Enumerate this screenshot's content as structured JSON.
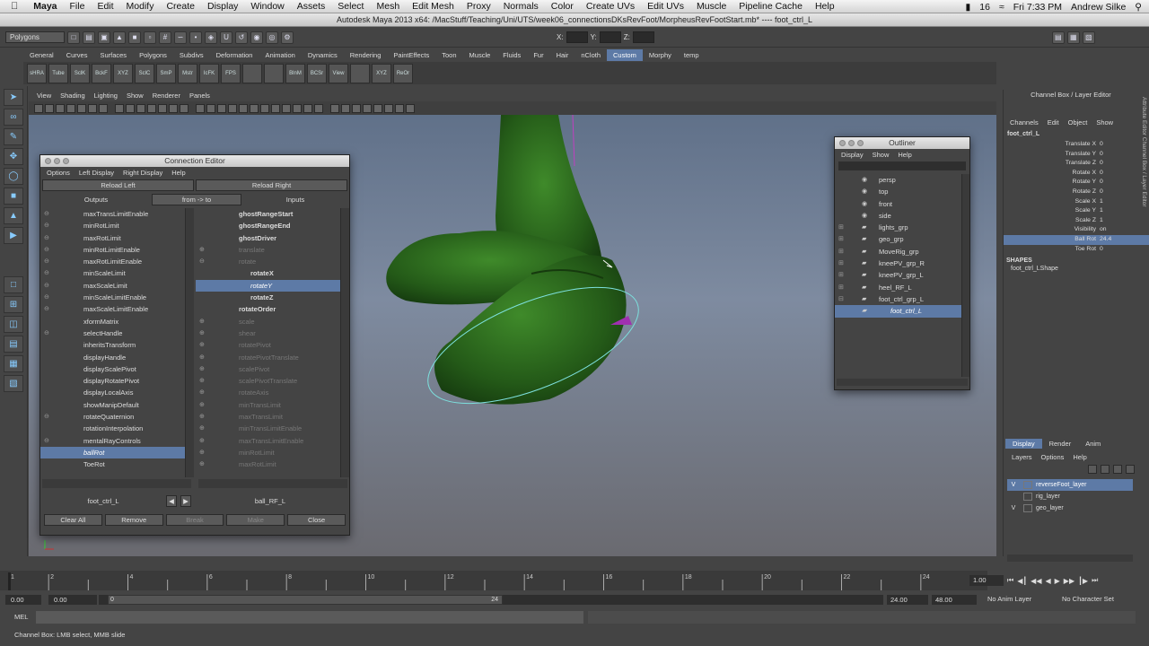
{
  "menubar": {
    "app": "Maya",
    "items": [
      "File",
      "Edit",
      "Modify",
      "Create",
      "Display",
      "Window",
      "Assets",
      "Select",
      "Mesh",
      "Edit Mesh",
      "Proxy",
      "Normals",
      "Color",
      "Create UVs",
      "Edit UVs",
      "Muscle",
      "Pipeline Cache",
      "Help"
    ],
    "battery": "16",
    "clock": "Fri 7:33 PM",
    "user": "Andrew Silke"
  },
  "title": "Autodesk Maya 2013 x64: /MacStuff/Teaching/Uni/UTS/week06_connectionsDKsRevFoot/MorpheusRevFootStart.mb*  ----  foot_ctrl_L",
  "status": {
    "mode": "Polygons",
    "x_label": "X:",
    "y_label": "Y:",
    "z_label": "Z:"
  },
  "shelf": {
    "tabs": [
      "General",
      "Curves",
      "Surfaces",
      "Polygons",
      "Subdivs",
      "Deformation",
      "Animation",
      "Dynamics",
      "Rendering",
      "PaintEffects",
      "Toon",
      "Muscle",
      "Fluids",
      "Fur",
      "Hair",
      "nCloth",
      "Custom",
      "Morphy",
      "temp"
    ],
    "active_tab": "Custom",
    "buttons": [
      "sHRA",
      "Tube",
      "SclK",
      "BckF",
      "XYZ",
      "SclC",
      "SmP",
      "Mstr",
      "IcFK",
      "FPS",
      "",
      "",
      "BlnM",
      "BCSr",
      "View",
      "",
      "XYZ",
      "ReOr"
    ]
  },
  "viewport": {
    "menu": [
      "View",
      "Shading",
      "Lighting",
      "Show",
      "Renderer",
      "Panels"
    ]
  },
  "connection_editor": {
    "title": "Connection Editor",
    "menu": [
      "Options",
      "Left Display",
      "Right Display",
      "Help"
    ],
    "reload_left": "Reload Left",
    "reload_right": "Reload Right",
    "outputs": "Outputs",
    "direction": "from -> to",
    "inputs": "Inputs",
    "left_items": [
      {
        "t": "maxTransLimitEnable",
        "ex": "⊖"
      },
      {
        "t": "minRotLimit",
        "ex": "⊖"
      },
      {
        "t": "maxRotLimit",
        "ex": "⊖"
      },
      {
        "t": "minRotLimitEnable",
        "ex": "⊖"
      },
      {
        "t": "maxRotLimitEnable",
        "ex": "⊖"
      },
      {
        "t": "minScaleLimit",
        "ex": "⊖"
      },
      {
        "t": "maxScaleLimit",
        "ex": "⊖"
      },
      {
        "t": "minScaleLimitEnable",
        "ex": "⊖"
      },
      {
        "t": "maxScaleLimitEnable",
        "ex": "⊖"
      },
      {
        "t": "xformMatrix",
        "ex": ""
      },
      {
        "t": "selectHandle",
        "ex": "⊖"
      },
      {
        "t": "inheritsTransform",
        "ex": ""
      },
      {
        "t": "displayHandle",
        "ex": ""
      },
      {
        "t": "displayScalePivot",
        "ex": ""
      },
      {
        "t": "displayRotatePivot",
        "ex": ""
      },
      {
        "t": "displayLocalAxis",
        "ex": ""
      },
      {
        "t": "showManipDefault",
        "ex": ""
      },
      {
        "t": "rotateQuaternion",
        "ex": "⊖"
      },
      {
        "t": "rotationInterpolation",
        "ex": ""
      },
      {
        "t": "mentalRayControls",
        "ex": "⊖"
      },
      {
        "t": "ballRot",
        "ex": "",
        "sel": true
      },
      {
        "t": "ToeRot",
        "ex": ""
      }
    ],
    "right_items": [
      {
        "t": "ghostRangeStart",
        "ex": "",
        "b": true
      },
      {
        "t": "ghostRangeEnd",
        "ex": "",
        "b": true
      },
      {
        "t": "ghostDriver",
        "ex": "",
        "b": true
      },
      {
        "t": "translate",
        "ex": "⊕",
        "d": true
      },
      {
        "t": "rotate",
        "ex": "⊖",
        "d": true
      },
      {
        "t": "rotateX",
        "ex": "",
        "b": true,
        "ind": true
      },
      {
        "t": "rotateY",
        "ex": "",
        "sel": true,
        "ind": true
      },
      {
        "t": "rotateZ",
        "ex": "",
        "b": true,
        "ind": true
      },
      {
        "t": "rotateOrder",
        "ex": "",
        "b": true
      },
      {
        "t": "scale",
        "ex": "⊕",
        "d": true
      },
      {
        "t": "shear",
        "ex": "⊕",
        "d": true
      },
      {
        "t": "rotatePivot",
        "ex": "⊕",
        "d": true
      },
      {
        "t": "rotatePivotTranslate",
        "ex": "⊕",
        "d": true
      },
      {
        "t": "scalePivot",
        "ex": "⊕",
        "d": true
      },
      {
        "t": "scalePivotTranslate",
        "ex": "⊕",
        "d": true
      },
      {
        "t": "rotateAxis",
        "ex": "⊕",
        "d": true
      },
      {
        "t": "minTransLimit",
        "ex": "⊕",
        "d": true
      },
      {
        "t": "maxTransLimit",
        "ex": "⊕",
        "d": true
      },
      {
        "t": "minTransLimitEnable",
        "ex": "⊕",
        "d": true
      },
      {
        "t": "maxTransLimitEnable",
        "ex": "⊕",
        "d": true
      },
      {
        "t": "minRotLimit",
        "ex": "⊕",
        "d": true
      },
      {
        "t": "maxRotLimit",
        "ex": "⊕",
        "d": true
      }
    ],
    "left_node": "foot_ctrl_L",
    "right_node": "ball_RF_L",
    "clear_all": "Clear All",
    "remove": "Remove",
    "break": "Break",
    "make": "Make",
    "close": "Close"
  },
  "outliner": {
    "title": "Outliner",
    "menu": [
      "Display",
      "Show",
      "Help"
    ],
    "items": [
      {
        "t": "persp",
        "ex": ""
      },
      {
        "t": "top",
        "ex": ""
      },
      {
        "t": "front",
        "ex": ""
      },
      {
        "t": "side",
        "ex": ""
      },
      {
        "t": "lights_grp",
        "ex": "⊞"
      },
      {
        "t": "geo_grp",
        "ex": "⊞"
      },
      {
        "t": "MoveRig_grp",
        "ex": "⊞"
      },
      {
        "t": "kneePV_grp_R",
        "ex": "⊞"
      },
      {
        "t": "kneePV_grp_L",
        "ex": "⊞"
      },
      {
        "t": "heel_RF_L",
        "ex": "⊞"
      },
      {
        "t": "foot_ctrl_grp_L",
        "ex": "⊟"
      },
      {
        "t": "foot_ctrl_L",
        "ex": "",
        "sel": true
      }
    ]
  },
  "channel_box": {
    "title": "Channel Box / Layer Editor",
    "menu": [
      "Channels",
      "Edit",
      "Object",
      "Show"
    ],
    "object": "foot_ctrl_L",
    "channels": [
      {
        "n": "Translate X",
        "v": "0"
      },
      {
        "n": "Translate Y",
        "v": "0"
      },
      {
        "n": "Translate Z",
        "v": "0"
      },
      {
        "n": "Rotate X",
        "v": "0"
      },
      {
        "n": "Rotate Y",
        "v": "0"
      },
      {
        "n": "Rotate Z",
        "v": "0"
      },
      {
        "n": "Scale X",
        "v": "1"
      },
      {
        "n": "Scale Y",
        "v": "1"
      },
      {
        "n": "Scale Z",
        "v": "1"
      },
      {
        "n": "Visibility",
        "v": "on"
      },
      {
        "n": "Ball Rot",
        "v": "24.4",
        "hl": true
      },
      {
        "n": "Toe Rot",
        "v": "0"
      }
    ],
    "shapes_label": "SHAPES",
    "shape": "foot_ctrl_LShape",
    "side_tabs": "Attribute Editor   Channel Box / Layer Editor"
  },
  "layers": {
    "tabs": [
      "Display",
      "Render",
      "Anim"
    ],
    "active": "Display",
    "menu": [
      "Layers",
      "Options",
      "Help"
    ],
    "items": [
      {
        "v": "V",
        "t": "reverseFoot_layer",
        "sel": true
      },
      {
        "v": "",
        "t": "rig_layer"
      },
      {
        "v": "V",
        "t": "geo_layer"
      }
    ]
  },
  "time": {
    "ticks": [
      "1",
      "2",
      "4",
      "6",
      "8",
      "10",
      "12",
      "14",
      "16",
      "18",
      "20",
      "22",
      "24"
    ],
    "current": "1.00",
    "start": "0.00",
    "playback_start": "0.00",
    "range_start_label": "0",
    "range_end_label": "24",
    "playback_end": "24.00",
    "end": "48.00",
    "anim_layer": "No Anim Layer",
    "char_set": "No Character Set"
  },
  "cmd_label": "MEL",
  "help_text": "Channel Box: LMB select, MMB slide",
  "colors": {
    "selection": "#5d7aa6",
    "foot": "#2d6a1e",
    "curve": "#7de0dd"
  }
}
